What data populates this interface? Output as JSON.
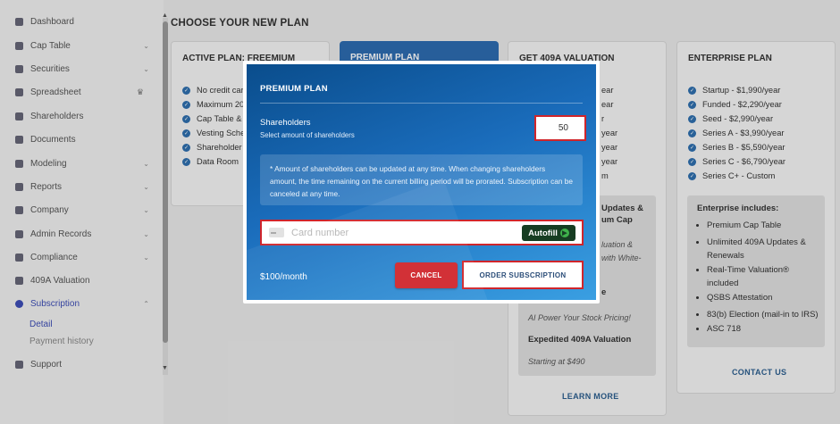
{
  "sidebar": {
    "items": [
      {
        "label": "Dashboard",
        "icon": "dashboard-icon"
      },
      {
        "label": "Cap Table",
        "icon": "pie-chart-icon",
        "chevron": "⌄"
      },
      {
        "label": "Securities",
        "icon": "document-icon",
        "chevron": "⌄"
      },
      {
        "label": "Spreadsheet",
        "icon": "spreadsheet-icon",
        "crown": "♛"
      },
      {
        "label": "Shareholders",
        "icon": "person-icon"
      },
      {
        "label": "Documents",
        "icon": "folder-icon"
      },
      {
        "label": "Modeling",
        "icon": "bulb-icon",
        "chevron": "⌄"
      },
      {
        "label": "Reports",
        "icon": "report-icon",
        "chevron": "⌄"
      },
      {
        "label": "Company",
        "icon": "company-icon",
        "chevron": "⌄"
      },
      {
        "label": "Admin Records",
        "icon": "gear-icon",
        "chevron": "⌄"
      },
      {
        "label": "Compliance",
        "icon": "shield-icon",
        "chevron": "⌄"
      },
      {
        "label": "409A Valuation",
        "icon": "chart-icon"
      },
      {
        "label": "Subscription",
        "icon": "dollar-icon",
        "chevron": "⌃"
      },
      {
        "label": "Support",
        "icon": "support-icon"
      }
    ],
    "sub_items": [
      "Detail",
      "Payment history"
    ]
  },
  "page": {
    "title": "CHOOSE YOUR NEW PLAN"
  },
  "active_plan": {
    "title": "ACTIVE PLAN: FREEMIUM",
    "features": [
      "No credit card",
      "Maximum 20",
      "Cap Table &",
      "Vesting Sche",
      "Shareholder",
      "Data Room"
    ]
  },
  "premium_plan": {
    "title": "PREMIUM PLAN"
  },
  "valuation_plan": {
    "title": "GET 409A VALUATION",
    "partial_features": [
      "ear",
      "ear",
      "r",
      "year",
      "year",
      "year",
      "m"
    ],
    "box_heading_1": "Updates &",
    "box_heading_2": "um Cap",
    "box_line_1": "luation &",
    "box_line_2": "with White-",
    "box_line_3": "e",
    "box_italic": "AI Power Your Stock Pricing!",
    "box_heading_3": "Expedited 409A Valuation",
    "box_italic_2": "Starting at $490",
    "link": "LEARN MORE"
  },
  "enterprise_plan": {
    "title": "ENTERPRISE PLAN",
    "features": [
      "Startup - $1,990/year",
      "Funded - $2,290/year",
      "Seed - $2,990/year",
      "Series A - $3,990/year",
      "Series B - $5,590/year",
      "Series C - $6,790/year",
      "Series C+ - Custom"
    ],
    "includes_title": "Enterprise includes:",
    "includes": [
      "Premium Cap Table",
      "Unlimited 409A Updates & Renewals",
      "Real-Time Valuation® included",
      "QSBS Attestation",
      "83(b) Election (mail-in to IRS)",
      "ASC 718"
    ],
    "link": "CONTACT US"
  },
  "modal": {
    "title": "PREMIUM PLAN",
    "shareholders_label": "Shareholders",
    "shareholders_sub": "Select amount of shareholders",
    "shareholders_value": "50",
    "info": "* Amount of shareholders can be updated at any time. When changing shareholders amount, the time remaining on the current billing period will be prorated. Subscription can be canceled at any time.",
    "card_placeholder": "Card number",
    "autofill_label": "Autofill",
    "price": "$100/month",
    "cancel_label": "CANCEL",
    "order_label": "ORDER SUBSCRIPTION"
  },
  "colors": {
    "accent": "#3d4db5",
    "danger": "#d0252b",
    "modal_blue": "#1a6cbb",
    "autofill": "#163d22"
  }
}
